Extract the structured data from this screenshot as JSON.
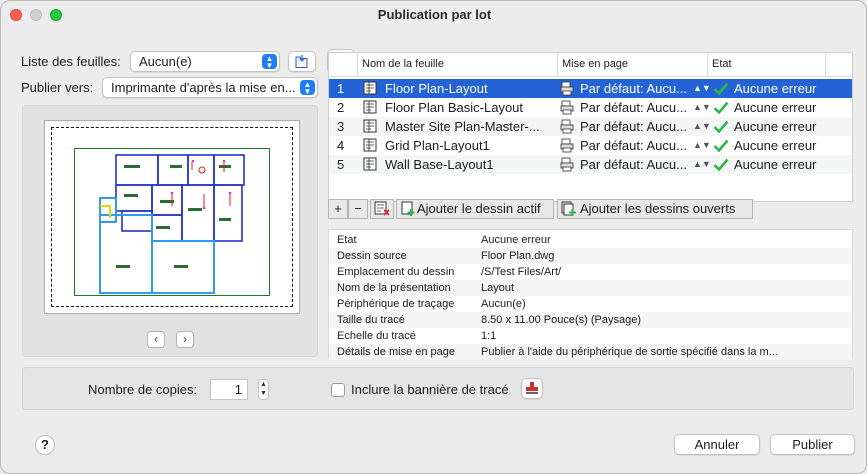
{
  "window": {
    "title": "Publication par lot"
  },
  "sheet_list": {
    "label": "Liste des feuilles:",
    "value": "Aucun(e)"
  },
  "publish_to": {
    "label": "Publier vers:",
    "value": "Imprimante d'après la mise en..."
  },
  "preview": {
    "prev": "‹",
    "next": "›"
  },
  "table": {
    "headers": {
      "name": "Nom de la feuille",
      "layout": "Mise en page",
      "status": "Etat"
    },
    "rows": [
      {
        "num": "1",
        "name": "Floor Plan-Layout",
        "layout": "Par défaut: Aucu...",
        "status": "Aucune erreur",
        "selected": true
      },
      {
        "num": "2",
        "name": "Floor Plan Basic-Layout",
        "layout": "Par défaut: Aucu...",
        "status": "Aucune erreur"
      },
      {
        "num": "3",
        "name": "Master Site Plan-Master-...",
        "layout": "Par défaut: Aucu...",
        "status": "Aucune erreur"
      },
      {
        "num": "4",
        "name": "Grid Plan-Layout1",
        "layout": "Par défaut: Aucu...",
        "status": "Aucune erreur"
      },
      {
        "num": "5",
        "name": "Wall Base-Layout1",
        "layout": "Par défaut: Aucu...",
        "status": "Aucune erreur"
      }
    ]
  },
  "toolbar": {
    "add": "+",
    "remove": "−",
    "add_active": "Ajouter le dessin actif",
    "add_open": "Ajouter les dessins ouverts"
  },
  "details": [
    {
      "key": "Etat",
      "value": "Aucune erreur"
    },
    {
      "key": "Dessin source",
      "value": "Floor Plan.dwg"
    },
    {
      "key": "Emplacement du dessin",
      "value": "/S/Test Files/Art/"
    },
    {
      "key": "Nom de la présentation",
      "value": "Layout"
    },
    {
      "key": "Périphérique de traçage",
      "value": "Aucun(e)"
    },
    {
      "key": "Taille du tracé",
      "value": "8.50 x 11.00 Pouce(s) (Paysage)"
    },
    {
      "key": "Echelle du tracé",
      "value": "1:1"
    },
    {
      "key": "Détails de mise en page",
      "value": "Publier à l'aide du périphérique de sortie spécifié dans la m..."
    }
  ],
  "copies": {
    "label": "Nombre de copies:",
    "value": "1"
  },
  "banner": {
    "label": "Inclure la bannière de tracé",
    "checked": false
  },
  "buttons": {
    "help": "?",
    "cancel": "Annuler",
    "publish": "Publier"
  },
  "colors": {
    "accent": "#2463d6",
    "success": "#2fb84a",
    "close": "#fe5f57",
    "max": "#28c840"
  }
}
